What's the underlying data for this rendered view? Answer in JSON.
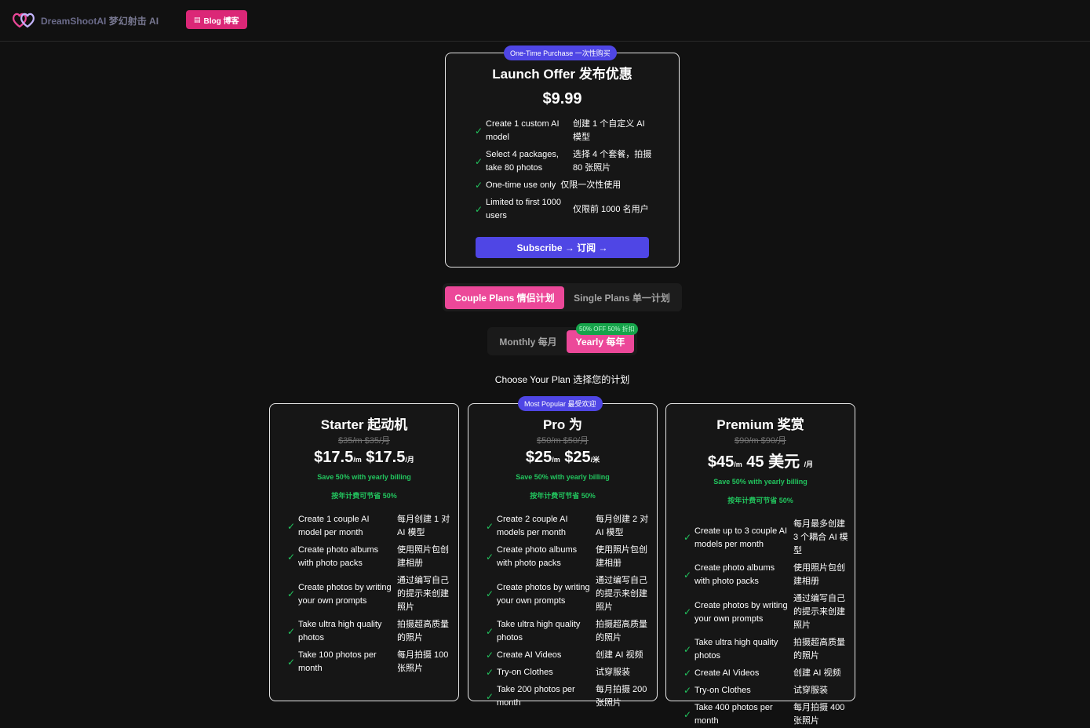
{
  "header": {
    "logo_text": "DreamShootAI",
    "logo_text_cn": "梦幻射击 AI",
    "blog_label": "Blog  博客",
    "blog_icon": "newspaper-icon"
  },
  "launch": {
    "badge": "One-Time Purchase  一次性购买",
    "title": "Launch Offer  发布优惠",
    "price": "$9.99",
    "features": [
      {
        "en": "Create 1 custom AI model",
        "zh": "创建 1 个自定义 AI 模型"
      },
      {
        "en": "Select 4 packages, take 80 photos",
        "zh": "选择 4 个套餐，拍摄 80 张照片"
      },
      {
        "en": "One-time use only",
        "zh": "仅限一次性使用"
      },
      {
        "en": "Limited to first 1000 users",
        "zh": "仅限前 1000 名用户"
      }
    ],
    "subscribe": "Subscribe →  订阅 →"
  },
  "plan_toggle": {
    "couple": "Couple Plans  情侣计划",
    "single": "Single Plans  单一计划"
  },
  "billing_toggle": {
    "monthly": "Monthly  每月",
    "yearly": "Yearly  每年",
    "badge": "50% OFF  50% 折扣"
  },
  "choose": "Choose Your Plan  选择您的计划",
  "plans": [
    {
      "title": "Starter  起动机",
      "old_price": "$35/m  $35/月",
      "price_a": "$17.5",
      "unit_a": "/m",
      "price_b": "$17.5",
      "unit_b": "/月",
      "save": "Save 50% with yearly billing",
      "save_cn": "按年计费可节省 50%",
      "features": [
        {
          "en": "Create 1 couple AI model per month",
          "zh": "每月创建 1 对 AI 模型"
        },
        {
          "en": "Create photo albums with photo packs",
          "zh": "使用照片包创建相册"
        },
        {
          "en": "Create photos by writing your own prompts",
          "zh": "通过编写自己的提示来创建照片"
        },
        {
          "en": "Take ultra high quality photos",
          "zh": "拍摄超高质量的照片"
        },
        {
          "en": "Take 100 photos per month",
          "zh": "每月拍摄 100 张照片"
        }
      ]
    },
    {
      "badge": "Most Popular  最受欢迎",
      "title": "Pro  为",
      "old_price": "$50/m  $50/月",
      "price_a": "$25",
      "unit_a": "/m",
      "price_b": "$25",
      "unit_b": "/米",
      "save": "Save 50% with yearly billing",
      "save_cn": "按年计费可节省 50%",
      "features": [
        {
          "en": "Create 2 couple AI models per month",
          "zh": "每月创建 2 对 AI 模型"
        },
        {
          "en": "Create photo albums with photo packs",
          "zh": "使用照片包创建相册"
        },
        {
          "en": "Create photos by writing your own prompts",
          "zh": "通过编写自己的提示来创建照片"
        },
        {
          "en": "Take ultra high quality photos",
          "zh": "拍摄超高质量的照片"
        },
        {
          "en": "Create AI Videos",
          "zh": "创建 AI 视频"
        },
        {
          "en": "Try-on Clothes",
          "zh": "试穿服装"
        },
        {
          "en": "Take 200 photos per month",
          "zh": "每月拍摄 200 张照片"
        }
      ]
    },
    {
      "title": "Premium  奖赏",
      "old_price": "$90/m  $90/月",
      "price_a": "$45",
      "unit_a": "/m",
      "price_b": "45 美元",
      "unit_b": "/月",
      "save": "Save 50% with yearly billing",
      "save_cn": "按年计费可节省 50%",
      "features": [
        {
          "en": "Create up to 3 couple AI models per month",
          "zh": "每月最多创建 3 个耦合 AI 模型"
        },
        {
          "en": "Create photo albums with photo packs",
          "zh": "使用照片包创建相册"
        },
        {
          "en": "Create photos by writing your own prompts",
          "zh": "通过编写自己的提示来创建照片"
        },
        {
          "en": "Take ultra high quality photos",
          "zh": "拍摄超高质量的照片"
        },
        {
          "en": "Create AI Videos",
          "zh": "创建 AI 视频"
        },
        {
          "en": "Try-on Clothes",
          "zh": "试穿服装"
        },
        {
          "en": "Take 400 photos per month",
          "zh": "每月拍摄 400 张照片"
        }
      ]
    }
  ],
  "colors": {
    "accent_pink": "#ec4899",
    "accent_indigo": "#4f46e5",
    "success": "#22c55e"
  }
}
